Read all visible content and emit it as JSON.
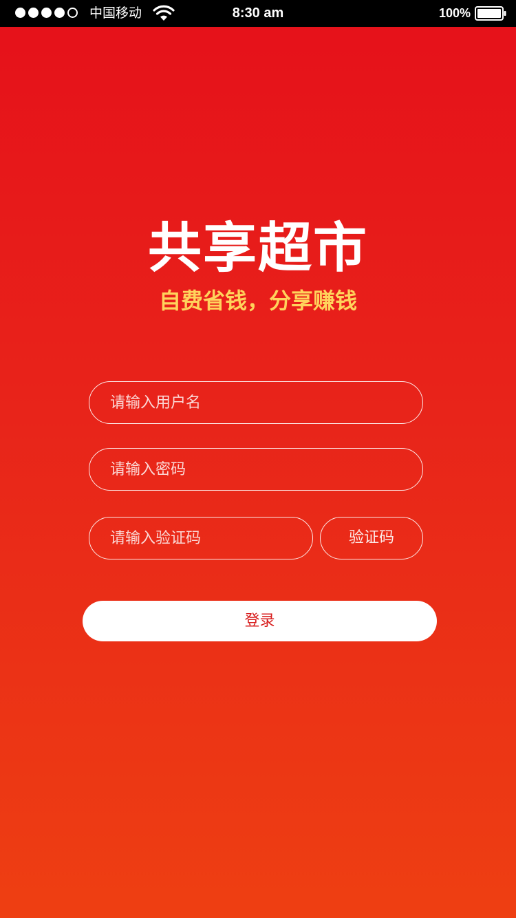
{
  "status_bar": {
    "signal_bars_filled": 4,
    "signal_bars_total": 5,
    "carrier": "中国移动",
    "wifi_icon": "wifi-icon",
    "time": "8:30 am",
    "battery_percent": "100%",
    "battery_icon": "battery-icon"
  },
  "logo": {
    "title": "共享超市",
    "slogan": "自费省钱，分享赚钱",
    "title_color": "#ffffff",
    "slogan_color": "#ffd35c"
  },
  "form": {
    "username": {
      "placeholder": "请输入用户名",
      "value": ""
    },
    "password": {
      "placeholder": "请输入密码",
      "value": ""
    },
    "code": {
      "placeholder": "请输入验证码",
      "value": ""
    },
    "code_button_label": "验证码",
    "login_label": "登录"
  },
  "colors": {
    "background_top": "#e6101a",
    "background_bottom": "#ee3f12",
    "login_text": "#d81e1e"
  }
}
